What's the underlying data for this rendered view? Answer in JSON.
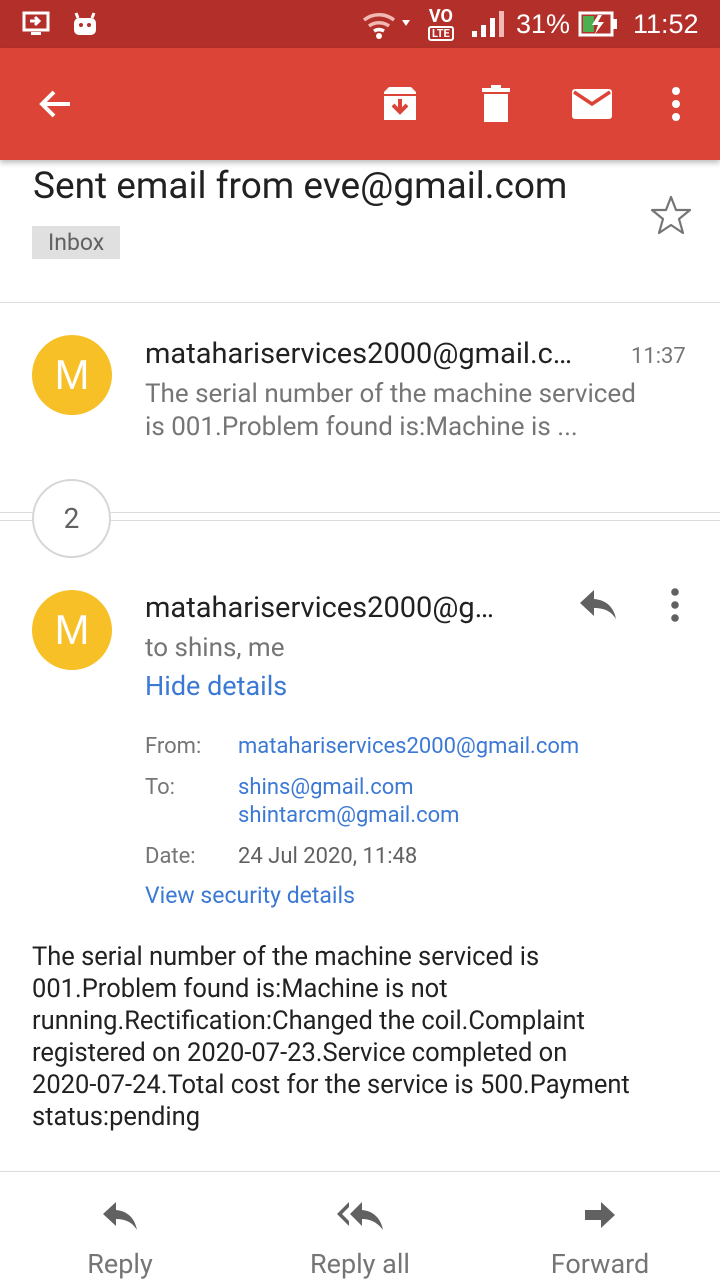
{
  "status_bar": {
    "network_label": "VO",
    "network_sub": "LTE",
    "battery_percent": "31%",
    "time": "11:52"
  },
  "app_bar": {
    "actions": [
      "back-icon",
      "archive-icon",
      "delete-icon",
      "mark-unread-icon",
      "more-vert-icon"
    ]
  },
  "email": {
    "subject": "Sent email from eve@gmail.com",
    "label": "Inbox"
  },
  "thread": {
    "collapsed_message": {
      "avatar_letter": "M",
      "sender": "matahariservices2000@gmail.c…",
      "time": "11:37",
      "snippet_line1": "The serial number of the machine serviced",
      "snippet_line2": "is 001.Problem found is:Machine is ..."
    },
    "hidden_count": "2",
    "expanded_message": {
      "avatar_letter": "M",
      "sender": "matahariservices2000@g…",
      "recipients": "to shins, me",
      "hide_details": "Hide details",
      "details": {
        "from_label": "From:",
        "from_value": "matahariservices2000@gmail.com",
        "to_label": "To:",
        "to_values": [
          "shins@gmail.com",
          "shintarcm@gmail.com"
        ],
        "date_label": "Date:",
        "date_value": "24 Jul 2020, 11:48",
        "security_link": "View security details"
      },
      "body_lines": [
        "The serial number of the machine serviced is",
        "001.Problem found is:Machine is not",
        "running.Rectification:Changed the coil.Complaint",
        "registered on 2020-07-23.Service completed on",
        "2020-07-24.Total cost for the service is 500.Payment",
        "status:pending"
      ]
    }
  },
  "bottom_actions": {
    "reply": "Reply",
    "reply_all": "Reply all",
    "forward": "Forward"
  },
  "colors": {
    "status_bar": "#b3302a",
    "app_bar": "#db4437",
    "avatar": "#f6c026",
    "link": "#3c79d4"
  }
}
